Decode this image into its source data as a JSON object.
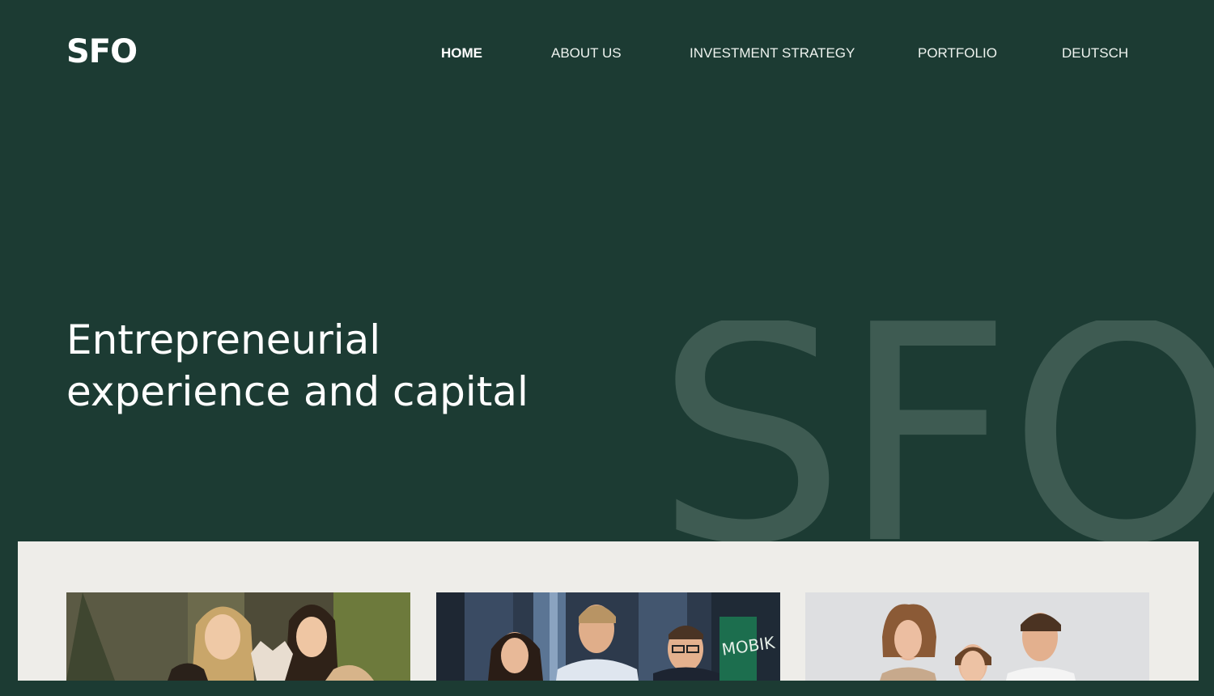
{
  "brand": {
    "logo_text": "SFO",
    "watermark_text": "SFO"
  },
  "nav": {
    "items": [
      {
        "label": "HOME",
        "active": true
      },
      {
        "label": "ABOUT US",
        "active": false
      },
      {
        "label": "INVESTMENT STRATEGY",
        "active": false
      },
      {
        "label": "PORTFOLIO",
        "active": false
      },
      {
        "label": "DEUTSCH",
        "active": false
      }
    ]
  },
  "hero": {
    "title_line1": "Entrepreneurial",
    "title_line2": "experience and capital"
  },
  "cards": [
    {
      "image": "team-photo-park-dogs"
    },
    {
      "image": "team-photo-office-mobik",
      "sign_text": "MOBIK"
    },
    {
      "image": "team-photo-studio"
    }
  ],
  "colors": {
    "background": "#1c3b33",
    "watermark": "#3e5b52",
    "panel": "#eeede9",
    "text": "#ffffff"
  }
}
